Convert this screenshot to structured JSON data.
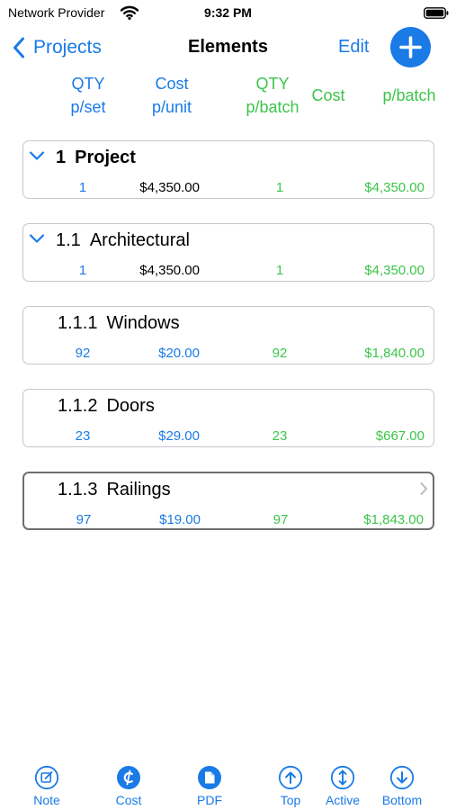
{
  "status_bar": {
    "carrier": "Network Provider",
    "time": "9:32 PM"
  },
  "nav": {
    "back_label": "Projects",
    "title": "Elements",
    "edit_label": "Edit"
  },
  "column_headers": {
    "qty_set": [
      "QTY",
      "p/set"
    ],
    "cost_unit": [
      "Cost",
      "p/unit"
    ],
    "qty_batch": [
      "QTY",
      "p/batch"
    ],
    "cost": "Cost",
    "p_batch": "p/batch"
  },
  "elements": [
    {
      "number": "1",
      "name": "Project",
      "qty_set": "1",
      "cost_unit": "$4,350.00",
      "qty_batch": "1",
      "batch_cost": "$4,350.00",
      "expandable": true,
      "bold": true
    },
    {
      "number": "1.1",
      "name": "Architectural",
      "qty_set": "1",
      "cost_unit": "$4,350.00",
      "qty_batch": "1",
      "batch_cost": "$4,350.00",
      "expandable": true,
      "bold": false
    },
    {
      "number": "1.1.1",
      "name": "Windows",
      "qty_set": "92",
      "cost_unit": "$20.00",
      "qty_batch": "92",
      "batch_cost": "$1,840.00",
      "expandable": false,
      "bold": false
    },
    {
      "number": "1.1.2",
      "name": "Doors",
      "qty_set": "23",
      "cost_unit": "$29.00",
      "qty_batch": "23",
      "batch_cost": "$667.00",
      "expandable": false,
      "bold": false
    },
    {
      "number": "1.1.3",
      "name": "Railings",
      "qty_set": "97",
      "cost_unit": "$19.00",
      "qty_batch": "97",
      "batch_cost": "$1,843.00",
      "expandable": false,
      "bold": false,
      "selected": true
    }
  ],
  "toolbar": [
    {
      "label": "Note",
      "icon": "note-icon"
    },
    {
      "label": "Cost",
      "icon": "cost-icon"
    },
    {
      "label": "PDF",
      "icon": "pdf-icon"
    },
    {
      "label": "Top",
      "icon": "arrow-up-icon"
    },
    {
      "label": "Active",
      "icon": "active-icon"
    },
    {
      "label": "Bottom",
      "icon": "arrow-down-icon"
    }
  ],
  "colors": {
    "accent": "#1a7ae6",
    "green": "#3cc54a",
    "card_border": "#c7c7cc",
    "selected_border": "#6d6d72"
  }
}
